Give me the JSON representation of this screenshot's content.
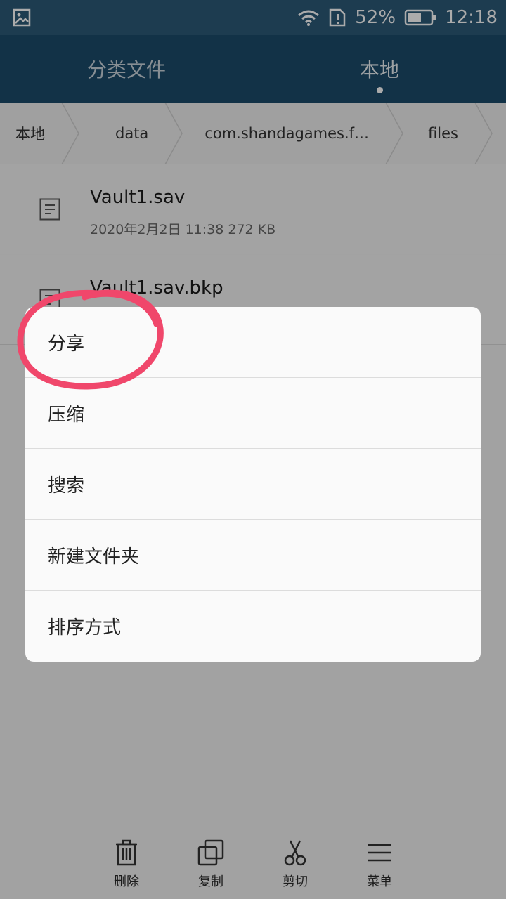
{
  "status_bar": {
    "battery": "52%",
    "time": "12:18"
  },
  "header": {
    "tabs": [
      {
        "label": "分类文件"
      },
      {
        "label": "本地"
      }
    ]
  },
  "breadcrumb": [
    "本地",
    "data",
    "com.shandagames.f…",
    "files"
  ],
  "files": [
    {
      "name": "Vault1.sav",
      "meta": "2020年2月2日 11:38 272 KB"
    },
    {
      "name": "Vault1.sav.bkp",
      "meta": ""
    }
  ],
  "menu": {
    "items": [
      {
        "label": "分享"
      },
      {
        "label": "压缩"
      },
      {
        "label": "搜索"
      },
      {
        "label": "新建文件夹"
      },
      {
        "label": "排序方式"
      }
    ]
  },
  "toolbar": {
    "items": [
      {
        "label": "删除",
        "icon": "trash-icon"
      },
      {
        "label": "复制",
        "icon": "copy-icon"
      },
      {
        "label": "剪切",
        "icon": "scissors-icon"
      },
      {
        "label": "菜单",
        "icon": "menu-icon"
      }
    ]
  },
  "colors": {
    "header": "#1b4b6b",
    "status_bar": "#2c5a78",
    "annotation": "#f0476b"
  }
}
